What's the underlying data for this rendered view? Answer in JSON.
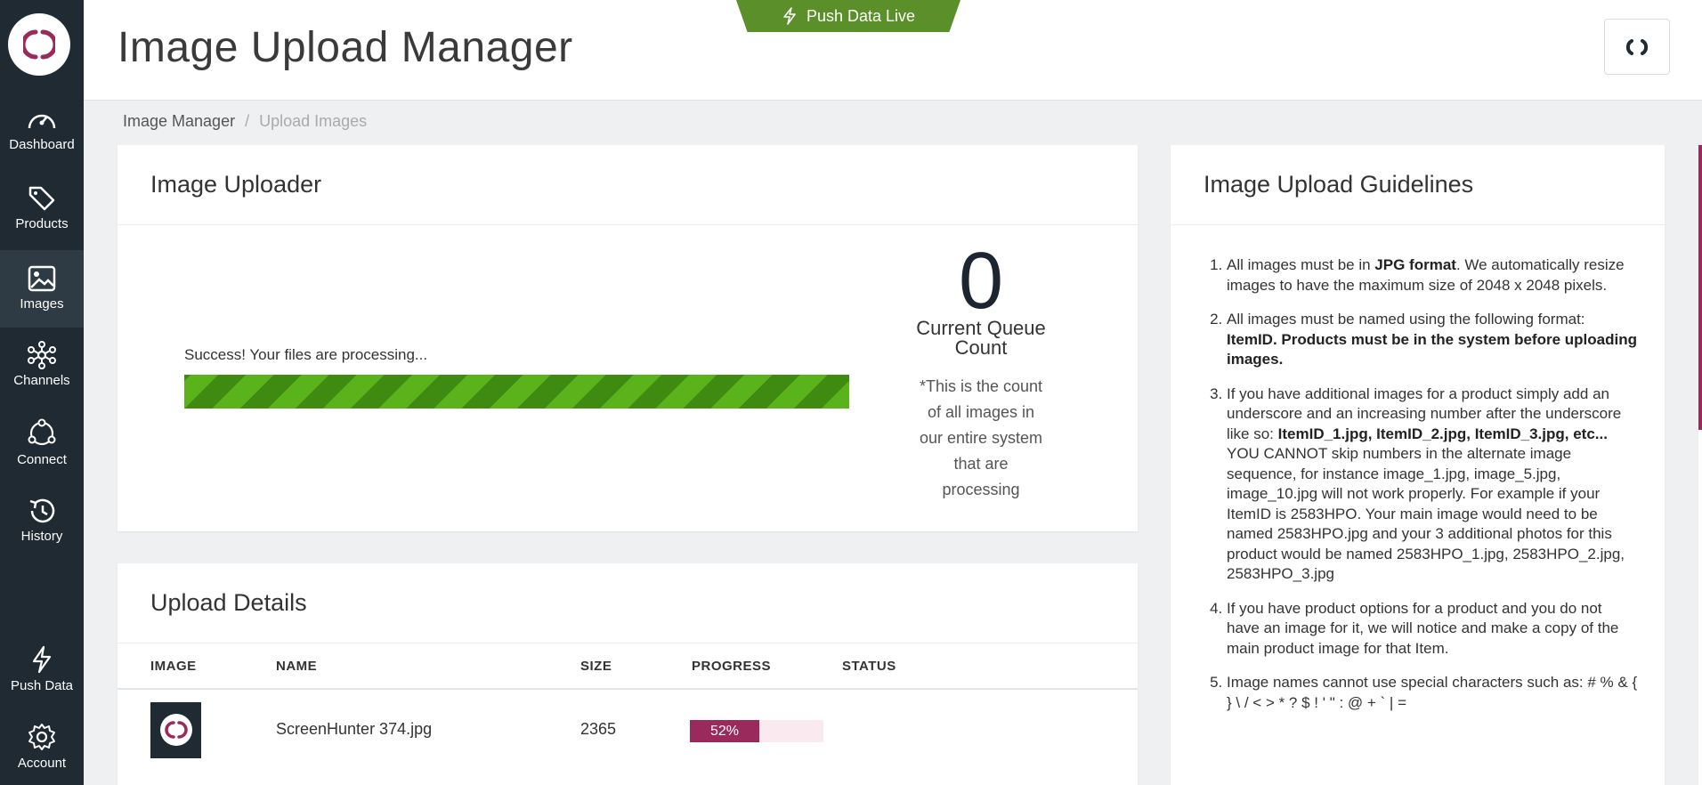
{
  "colors": {
    "sidebar": "#1f2a33",
    "accent": "#9a2a5c",
    "push_green": "#5a8f2a",
    "progress_green": "#4f9a14"
  },
  "header": {
    "title": "Image Upload Manager",
    "push_live_label": "Push Data Live"
  },
  "sidebar": {
    "items": [
      {
        "label": "Dashboard",
        "icon": "gauge-icon"
      },
      {
        "label": "Products",
        "icon": "tag-icon"
      },
      {
        "label": "Images",
        "icon": "image-icon"
      },
      {
        "label": "Channels",
        "icon": "network-icon"
      },
      {
        "label": "Connect",
        "icon": "cycle-icon"
      },
      {
        "label": "History",
        "icon": "history-icon"
      },
      {
        "label": "Push Data",
        "icon": "bolt-icon"
      },
      {
        "label": "Account",
        "icon": "gear-icon"
      }
    ],
    "active": "Images"
  },
  "breadcrumb": {
    "parent": "Image Manager",
    "current": "Upload Images"
  },
  "uploader": {
    "title": "Image Uploader",
    "status_message": "Success! Your files are processing...",
    "progress": 1.0,
    "queue_count": "0",
    "queue_label": "Current Queue Count",
    "queue_note": "*This is the count of all images in our entire system that are processing"
  },
  "upload_details": {
    "title": "Upload Details",
    "columns": [
      "IMAGE",
      "NAME",
      "SIZE",
      "PROGRESS",
      "STATUS"
    ],
    "rows": [
      {
        "name": "ScreenHunter 374.jpg",
        "size": "2365",
        "progress_label": "52%",
        "progress": 0.52,
        "status": ""
      }
    ]
  },
  "guidelines": {
    "title": "Image Upload Guidelines",
    "items": [
      [
        "All images must be in ",
        "JPG format",
        ". We automatically resize images to have the maximum size of 2048 x 2048 pixels."
      ],
      [
        "All images must be named using the following format: ",
        "ItemID. Products must be in the system before uploading images.",
        ""
      ],
      [
        "If you have additional images for a product simply add an underscore and an increasing number after the underscore like so: ",
        "ItemID_1.jpg, ItemID_2.jpg, ItemID_3.jpg, etc...",
        " YOU CANNOT skip numbers in the alternate image sequence, for instance image_1.jpg, image_5.jpg, image_10.jpg will not work properly. For example if your ItemID is 2583HPO. Your main image would need to be named 2583HPO.jpg and your 3 additional photos for this product would be named 2583HPO_1.jpg, 2583HPO_2.jpg, 2583HPO_3.jpg"
      ],
      [
        "If you have product options for a product and you do not have an image for it, we will notice and make a copy of the main product image for that Item.",
        "",
        ""
      ],
      [
        "Image names cannot use special characters such as: # % & { } \\ / < > * ? $ ! ' \" : @ + ` | =",
        "",
        ""
      ]
    ]
  }
}
